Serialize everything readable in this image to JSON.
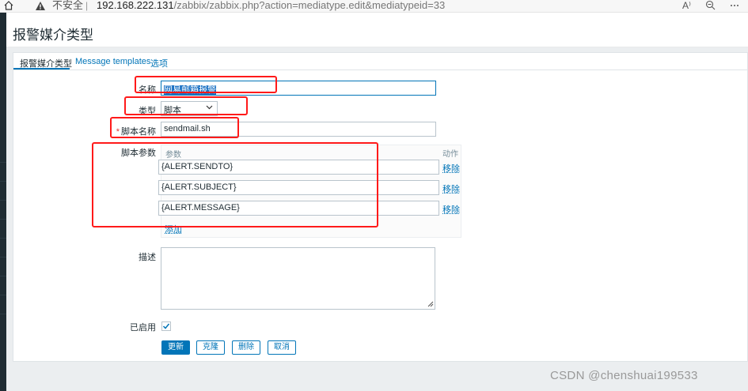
{
  "browser": {
    "insecure_label": "不安全",
    "separator": "|",
    "url_host": "192.168.222.131",
    "url_path": "/zabbix/zabbix.php?action=mediatype.edit&mediatypeid=33",
    "read_aloud_glyph": "A⁾"
  },
  "page": {
    "title": "报警媒介类型"
  },
  "tabs": [
    {
      "label": "报警媒介类型",
      "active": true
    },
    {
      "label": "Message templates",
      "active": false
    },
    {
      "label": "选项",
      "active": false
    }
  ],
  "form": {
    "name_label": "名称",
    "name_value": "网易邮箱报警",
    "type_label": "类型",
    "type_value": "脚本",
    "script_name_label": "脚本名称",
    "script_name_value": "sendmail.sh",
    "script_params_label": "脚本参数",
    "params_header": "参数",
    "action_header": "动作",
    "params": [
      {
        "value": "{ALERT.SENDTO}",
        "remove_label": "移除"
      },
      {
        "value": "{ALERT.SUBJECT}",
        "remove_label": "移除"
      },
      {
        "value": "{ALERT.MESSAGE}",
        "remove_label": "移除"
      }
    ],
    "add_label": "添加",
    "description_label": "描述",
    "description_value": "",
    "enabled_label": "已启用",
    "enabled": true
  },
  "buttons": {
    "update": "更新",
    "clone": "克隆",
    "delete": "删除",
    "cancel": "取消"
  },
  "watermark": "CSDN @chenshuai199533",
  "colors": {
    "accent": "#0275b8",
    "annotation_red": "#ff1a1a",
    "sidebar": "#1f2c33"
  }
}
